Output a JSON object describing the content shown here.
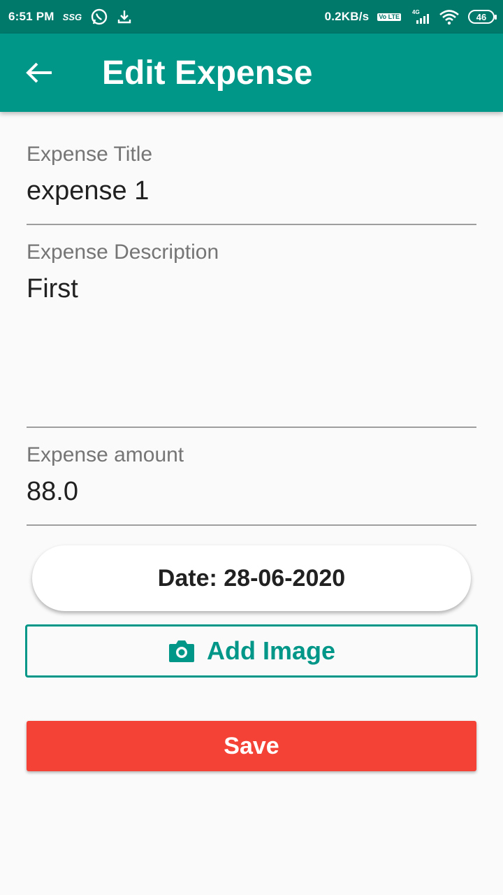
{
  "status_bar": {
    "time": "6:51 PM",
    "carrier_tag": "SSG",
    "net_speed": "0.2KB/s",
    "volte": "Vo LTE",
    "network": "4G",
    "battery": "46",
    "icons": [
      "whatsapp-icon",
      "download-icon",
      "signal-icon",
      "wifi-icon",
      "battery-icon"
    ]
  },
  "app_bar": {
    "title": "Edit Expense",
    "back_icon": "arrow-left-icon",
    "color": "#009688"
  },
  "form": {
    "title_label": "Expense Title",
    "title_value": "expense 1",
    "description_label": "Expense Description",
    "description_value": "First",
    "amount_label": "Expense amount",
    "amount_value": "88.0"
  },
  "actions": {
    "date_label": "Date: 28-06-2020",
    "add_image_label": "Add Image",
    "add_image_icon": "camera-icon",
    "save_label": "Save",
    "save_color": "#f44336"
  }
}
